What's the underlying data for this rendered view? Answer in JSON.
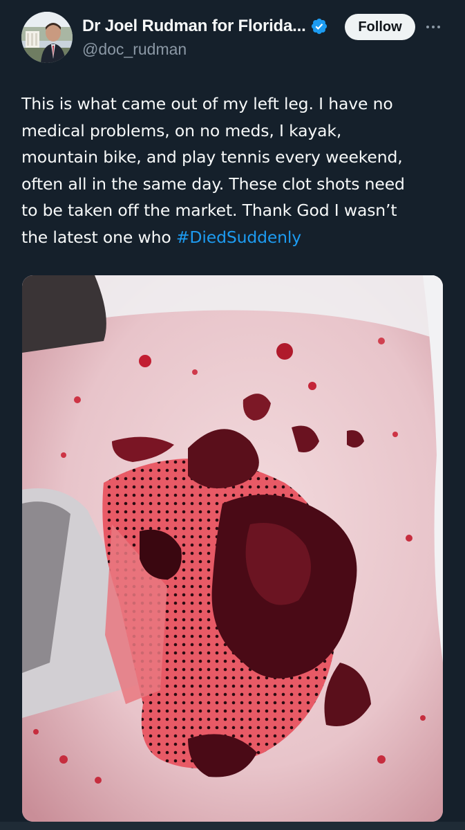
{
  "author": {
    "display_name": "Dr Joel Rudman for Florida...",
    "handle": "@doc_rudman",
    "verified": true,
    "avatar_icon": "avatar-photo"
  },
  "actions": {
    "follow_label": "Follow",
    "more_icon": "more-horizontal-icon"
  },
  "tweet": {
    "lines": [
      "This is what came out of my left leg. I have no",
      "medical problems, on no meds, I kayak,",
      "mountain bike, and play tennis every weekend,",
      "often all in the same day.  These clot shots need",
      "to be taken off the market. Thank God I wasn’t"
    ],
    "last_line_prefix": "the latest one who ",
    "hashtag": "#DiedSuddenly"
  },
  "colors": {
    "background": "#15202b",
    "text": "#f7f9f9",
    "secondary_text": "#8b98a5",
    "link": "#1d9bf0",
    "verified_badge": "#1d9bf0",
    "follow_button_bg": "#eff3f4"
  }
}
